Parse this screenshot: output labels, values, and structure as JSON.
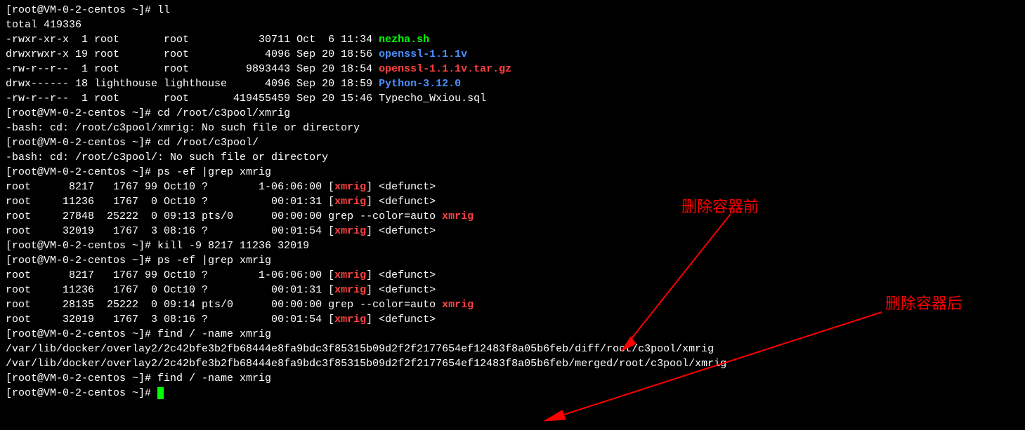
{
  "prompt": "[root@VM-0-2-centos ~]# ",
  "cmd_ll": "ll",
  "total": "total 419336",
  "ls_rows": [
    {
      "perm": "-rwxr-xr-x",
      "links": " 1",
      "owner": "root      ",
      "group": "root      ",
      "size": "    30711",
      "date": "Oct  6 11:34",
      "name": "nezha.sh",
      "cls": "green bold"
    },
    {
      "perm": "drwxrwxr-x",
      "links": "19",
      "owner": "root      ",
      "group": "root      ",
      "size": "     4096",
      "date": "Sep 20 18:56",
      "name": "openssl-1.1.1v",
      "cls": "blue bold"
    },
    {
      "perm": "-rw-r--r--",
      "links": " 1",
      "owner": "root      ",
      "group": "root      ",
      "size": "  9893443",
      "date": "Sep 20 18:54",
      "name": "openssl-1.1.1v.tar.gz",
      "cls": "red bold"
    },
    {
      "perm": "drwx------",
      "links": "18",
      "owner": "lighthouse",
      "group": "lighthouse",
      "size": "     4096",
      "date": "Sep 20 18:59",
      "name": "Python-3.12.0",
      "cls": "blue bold"
    },
    {
      "perm": "-rw-r--r--",
      "links": " 1",
      "owner": "root      ",
      "group": "root      ",
      "size": "419455459",
      "date": "Sep 20 15:46",
      "name": "Typecho_Wxiou.sql",
      "cls": ""
    }
  ],
  "cmd_cd1": "cd /root/c3pool/xmrig",
  "err_cd1": "-bash: cd: /root/c3pool/xmrig: No such file or directory",
  "cmd_cd2": "cd /root/c3pool/",
  "err_cd2": "-bash: cd: /root/c3pool/: No such file or directory",
  "cmd_ps1": "ps -ef |grep xmrig",
  "ps1": [
    {
      "user": "root",
      "pid": "     8217",
      "ppid": "  1767",
      "c": "99",
      "stime": "Oct10",
      "tty": "?       ",
      "time": "1-06:06:00",
      "cmd_pre": "[",
      "cmd_hl": "xmrig",
      "cmd_post": "] <defunct>"
    },
    {
      "user": "root",
      "pid": "    11236",
      "ppid": "  1767",
      "c": " 0",
      "stime": "Oct10",
      "tty": "?       ",
      "time": "  00:01:31",
      "cmd_pre": "[",
      "cmd_hl": "xmrig",
      "cmd_post": "] <defunct>"
    },
    {
      "user": "root",
      "pid": "    27848",
      "ppid": " 25222",
      "c": " 0",
      "stime": "09:13",
      "tty": "pts/0   ",
      "time": "  00:00:00",
      "cmd_pre": "grep --color=auto ",
      "cmd_hl": "xmrig",
      "cmd_post": ""
    },
    {
      "user": "root",
      "pid": "    32019",
      "ppid": "  1767",
      "c": " 3",
      "stime": "08:16",
      "tty": "?       ",
      "time": "  00:01:54",
      "cmd_pre": "[",
      "cmd_hl": "xmrig",
      "cmd_post": "] <defunct>"
    }
  ],
  "cmd_kill": "kill -9 8217 11236 32019",
  "cmd_ps2": "ps -ef |grep xmrig",
  "ps2": [
    {
      "user": "root",
      "pid": "     8217",
      "ppid": "  1767",
      "c": "99",
      "stime": "Oct10",
      "tty": "?       ",
      "time": "1-06:06:00",
      "cmd_pre": "[",
      "cmd_hl": "xmrig",
      "cmd_post": "] <defunct>"
    },
    {
      "user": "root",
      "pid": "    11236",
      "ppid": "  1767",
      "c": " 0",
      "stime": "Oct10",
      "tty": "?       ",
      "time": "  00:01:31",
      "cmd_pre": "[",
      "cmd_hl": "xmrig",
      "cmd_post": "] <defunct>"
    },
    {
      "user": "root",
      "pid": "    28135",
      "ppid": " 25222",
      "c": " 0",
      "stime": "09:14",
      "tty": "pts/0   ",
      "time": "  00:00:00",
      "cmd_pre": "grep --color=auto ",
      "cmd_hl": "xmrig",
      "cmd_post": ""
    },
    {
      "user": "root",
      "pid": "    32019",
      "ppid": "  1767",
      "c": " 3",
      "stime": "08:16",
      "tty": "?       ",
      "time": "  00:01:54",
      "cmd_pre": "[",
      "cmd_hl": "xmrig",
      "cmd_post": "] <defunct>"
    }
  ],
  "cmd_find1": "find / -name xmrig",
  "find_out1": "/var/lib/docker/overlay2/2c42bfe3b2fb68444e8fa9bdc3f85315b09d2f2f2177654ef12483f8a05b6feb/diff/root/c3pool/xmrig",
  "find_out2": "/var/lib/docker/overlay2/2c42bfe3b2fb68444e8fa9bdc3f85315b09d2f2f2177654ef12483f8a05b6feb/merged/root/c3pool/xmrig",
  "cmd_find2": "find / -name xmrig",
  "annotation_before": "删除容器前",
  "annotation_after": "删除容器后"
}
